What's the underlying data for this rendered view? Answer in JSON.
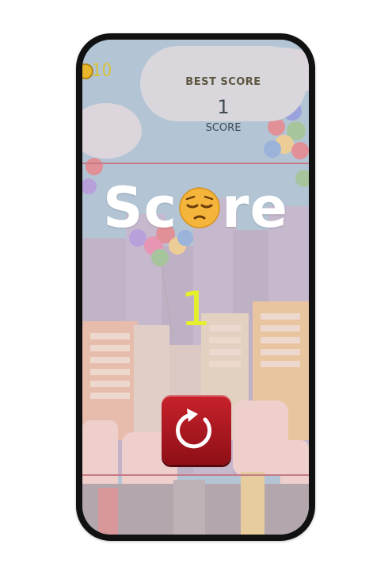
{
  "hud": {
    "coins": "10",
    "coin_icon": "coin-icon"
  },
  "scoreboard": {
    "best_label": "BEST SCORE",
    "current_score": "1",
    "score_label": "SCORE"
  },
  "game_over": {
    "title_start": "Sc",
    "title_end": "re",
    "title_emoji": "pensive-face-emoji",
    "result": "1"
  },
  "restart_button": {
    "icon": "restart-icon"
  },
  "colors": {
    "accent": "#e6ef2b",
    "button": "#b31a23",
    "overlay": "#ebd7e1"
  }
}
